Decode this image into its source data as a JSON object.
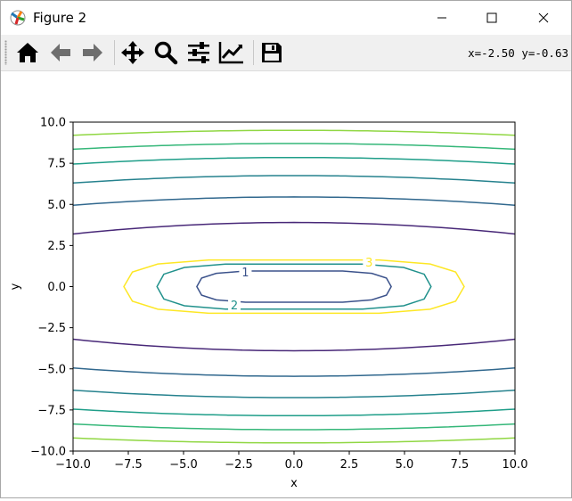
{
  "window": {
    "title": "Figure 2",
    "icons": {
      "app": "matplotlib-icon",
      "minimize": "minimize-icon",
      "maximize": "maximize-icon",
      "close": "close-icon"
    }
  },
  "toolbar": {
    "buttons": [
      {
        "name": "home",
        "icon": "home-icon"
      },
      {
        "name": "back",
        "icon": "arrow-left-icon"
      },
      {
        "name": "forward",
        "icon": "arrow-right-icon"
      },
      {
        "name": "pan",
        "icon": "pan-move-icon"
      },
      {
        "name": "zoom",
        "icon": "zoom-magnifier-icon"
      },
      {
        "name": "subplots",
        "icon": "sliders-icon"
      },
      {
        "name": "customize",
        "icon": "line-chart-icon"
      },
      {
        "name": "save",
        "icon": "floppy-disk-icon"
      }
    ],
    "coords": "x=-2.50 y=-0.63"
  },
  "chart_data": {
    "type": "contour",
    "xlabel": "x",
    "ylabel": "y",
    "xlim": [
      -10,
      10
    ],
    "ylim": [
      -10,
      10
    ],
    "xticks": [
      -10,
      -7.5,
      -5,
      -2.5,
      0,
      2.5,
      5,
      7.5,
      10
    ],
    "xtick_labels": [
      "−10.0",
      "−7.5",
      "−5.0",
      "−2.5",
      "0.0",
      "2.5",
      "5.0",
      "7.5",
      "10.0"
    ],
    "yticks": [
      -10,
      -7.5,
      -5,
      -2.5,
      0,
      2.5,
      5,
      7.5,
      10
    ],
    "ytick_labels": [
      "−10.0",
      "−7.5",
      "−5.0",
      "−2.5",
      "0.0",
      "2.5",
      "5.0",
      "7.5",
      "10.0"
    ],
    "grid": false,
    "colormap": "viridis",
    "inner_contours": [
      {
        "level": 1,
        "label": "1",
        "color": "#3b528b",
        "x_half": 4.4,
        "y_half": 0.95
      },
      {
        "level": 2,
        "label": "2",
        "color": "#21918c",
        "x_half": 6.2,
        "y_half": 1.37
      },
      {
        "level": 3,
        "label": "3",
        "color": "#fde725",
        "x_half": 7.7,
        "y_half": 1.62
      }
    ],
    "horizontal_contours": [
      {
        "color": "#482878",
        "y_center": 3.9,
        "y_edge": 3.2
      },
      {
        "color": "#31688e",
        "y_center": 5.45,
        "y_edge": 4.95
      },
      {
        "color": "#26828e",
        "y_center": 6.75,
        "y_edge": 6.3
      },
      {
        "color": "#1f9e89",
        "y_center": 7.85,
        "y_edge": 7.45
      },
      {
        "color": "#35b779",
        "y_center": 8.7,
        "y_edge": 8.35
      },
      {
        "color": "#90d743",
        "y_center": 9.5,
        "y_edge": 9.2
      }
    ]
  }
}
